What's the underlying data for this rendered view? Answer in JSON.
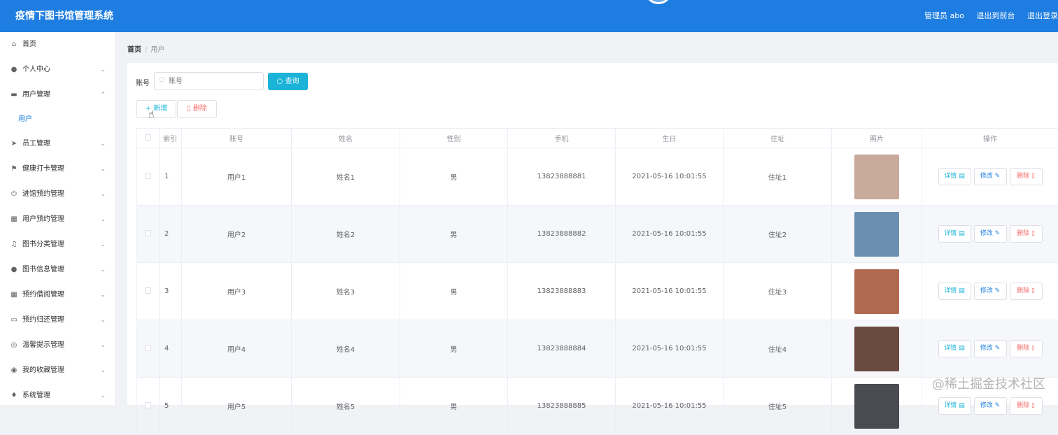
{
  "header": {
    "title": "疫情下图书馆管理系统",
    "links": [
      "管理员 abo",
      "退出到前台",
      "退出登录"
    ]
  },
  "sidebar": {
    "items": [
      {
        "label": "首页",
        "icon": "home-icon",
        "glyph": "⌂",
        "chevron": ""
      },
      {
        "label": "个人中心",
        "icon": "user-icon",
        "glyph": "●",
        "chevron": "⌄"
      },
      {
        "label": "用户管理",
        "icon": "ticket-icon",
        "glyph": "▬",
        "chevron": "⌃"
      },
      {
        "label": "员工管理",
        "icon": "send-icon",
        "glyph": "➤",
        "chevron": "⌄"
      },
      {
        "label": "健康打卡管理",
        "icon": "flag-icon",
        "glyph": "⚑",
        "chevron": "⌄"
      },
      {
        "label": "进馆预约管理",
        "icon": "power-icon",
        "glyph": "⏻",
        "chevron": "⌄"
      },
      {
        "label": "用户预约管理",
        "icon": "grid-icon",
        "glyph": "▦",
        "chevron": "⌄"
      },
      {
        "label": "图书分类管理",
        "icon": "bell-icon",
        "glyph": "♫",
        "chevron": "⌄"
      },
      {
        "label": "图书信息管理",
        "icon": "person-icon",
        "glyph": "●",
        "chevron": "⌄"
      },
      {
        "label": "预约借阅管理",
        "icon": "apps-icon",
        "glyph": "▦",
        "chevron": "⌄"
      },
      {
        "label": "预约归还管理",
        "icon": "chat-icon",
        "glyph": "▭",
        "chevron": "⌄"
      },
      {
        "label": "温馨提示管理",
        "icon": "basketball-icon",
        "glyph": "◎",
        "chevron": "⌄"
      },
      {
        "label": "我的收藏管理",
        "icon": "compass-icon",
        "glyph": "◉",
        "chevron": "⌄"
      },
      {
        "label": "系统管理",
        "icon": "mic-icon",
        "glyph": "♦",
        "chevron": "⌄"
      }
    ],
    "submenu_user": "用户"
  },
  "breadcrumb": {
    "home": "首页",
    "separator": "/",
    "current": "用户"
  },
  "search": {
    "label": "账号",
    "placeholder": "账号",
    "query_label": "查询"
  },
  "toolbar": {
    "add_label": "+ 新增",
    "delete_label": "删除"
  },
  "table": {
    "columns": [
      "",
      "索引",
      "账号",
      "姓名",
      "性别",
      "手机",
      "生日",
      "住址",
      "照片",
      "操作"
    ],
    "rows": [
      {
        "index": "1",
        "account": "用户1",
        "name": "姓名1",
        "gender": "男",
        "phone": "13823888881",
        "birthday": "2021-05-16 10:01:55",
        "address": "住址1",
        "photo_color": "#c9a99a"
      },
      {
        "index": "2",
        "account": "用户2",
        "name": "姓名2",
        "gender": "男",
        "phone": "13823888882",
        "birthday": "2021-05-16 10:01:55",
        "address": "住址2",
        "photo_color": "#6b8fb0"
      },
      {
        "index": "3",
        "account": "用户3",
        "name": "姓名3",
        "gender": "男",
        "phone": "13823888883",
        "birthday": "2021-05-16 10:01:55",
        "address": "住址3",
        "photo_color": "#b06a52"
      },
      {
        "index": "4",
        "account": "用户4",
        "name": "姓名4",
        "gender": "男",
        "phone": "13823888884",
        "birthday": "2021-05-16 10:01:55",
        "address": "住址4",
        "photo_color": "#6b4a40"
      },
      {
        "index": "5",
        "account": "用户5",
        "name": "姓名5",
        "gender": "男",
        "phone": "13823888885",
        "birthday": "2021-05-16 10:01:55",
        "address": "住址5",
        "photo_color": "#4a4a52"
      }
    ],
    "actions": {
      "detail": "详情",
      "edit": "修改",
      "delete": "删除"
    }
  },
  "watermark": "@稀土掘金技术社区"
}
